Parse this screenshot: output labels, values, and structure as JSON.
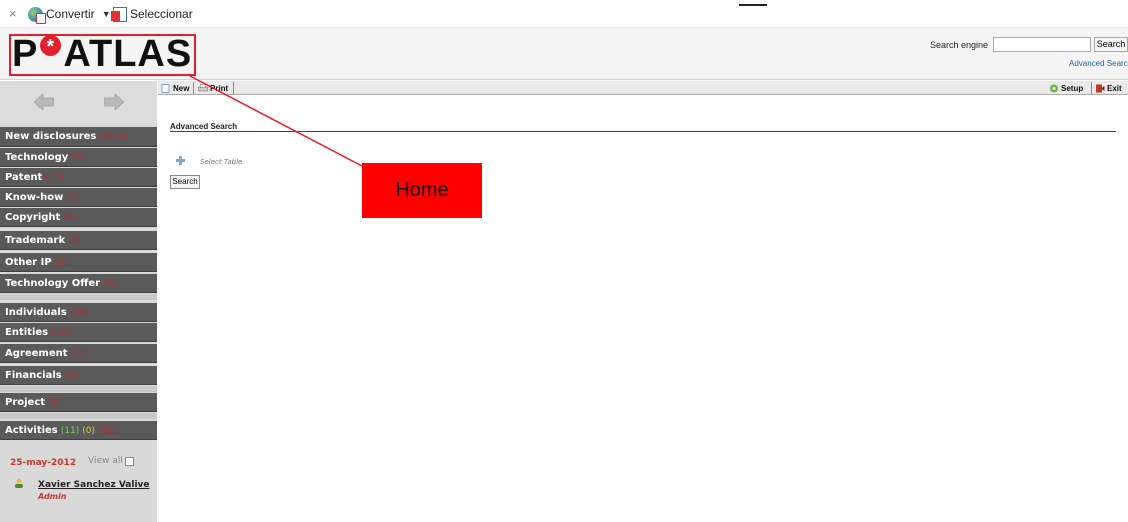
{
  "browser": {
    "close_glyph": "×",
    "convert_label": "Convertir",
    "select_label": "Seleccionar",
    "convert_icon": "convert-globe-icon",
    "select_icon": "pdf-select-icon"
  },
  "header": {
    "logo_left": "P",
    "logo_star": "*",
    "logo_right": "ATLAS",
    "search_label": "Search engine",
    "search_value": "",
    "search_button": "Search",
    "advanced_link": "Advanced Search"
  },
  "sidebar": {
    "items": [
      {
        "label": "New disclosures",
        "count": "(0)",
        "extra": "(0)"
      },
      {
        "label": "Technology",
        "count": "(0)"
      },
      {
        "label": "Patent",
        "count": "(17)"
      },
      {
        "label": "Know-how",
        "count": "(3)"
      },
      {
        "label": "Copyright",
        "count": "(0)"
      },
      {
        "label": "Trademark",
        "count": "(0)"
      },
      {
        "label": "Other IP",
        "count": "(0)"
      },
      {
        "label": "Technology Offer",
        "count": "(0)"
      },
      {
        "label": "Individuals",
        "count": "(14)"
      },
      {
        "label": "Entities",
        "count": "(15)"
      },
      {
        "label": "Agreement",
        "count": "(17)"
      },
      {
        "label": "Financials",
        "count": "(0)"
      },
      {
        "label": "Project",
        "count": "(0)"
      },
      {
        "label": "Activities",
        "count_green": "(11)",
        "count_yellow": "(0)",
        "count_red": "(18)"
      }
    ],
    "date": "25-may-2012",
    "view_all": "View all",
    "user_name": "Xavier Sanchez Valive",
    "user_role": "Admin"
  },
  "toolbar": {
    "new_label": "New",
    "print_label": "Print",
    "setup_label": "Setup",
    "exit_label": "Exit"
  },
  "main": {
    "title": "Advanced Search",
    "select_table": "Select Table",
    "search_button": "Search"
  },
  "annotation": {
    "label": "Home",
    "color": "#ff0000"
  }
}
